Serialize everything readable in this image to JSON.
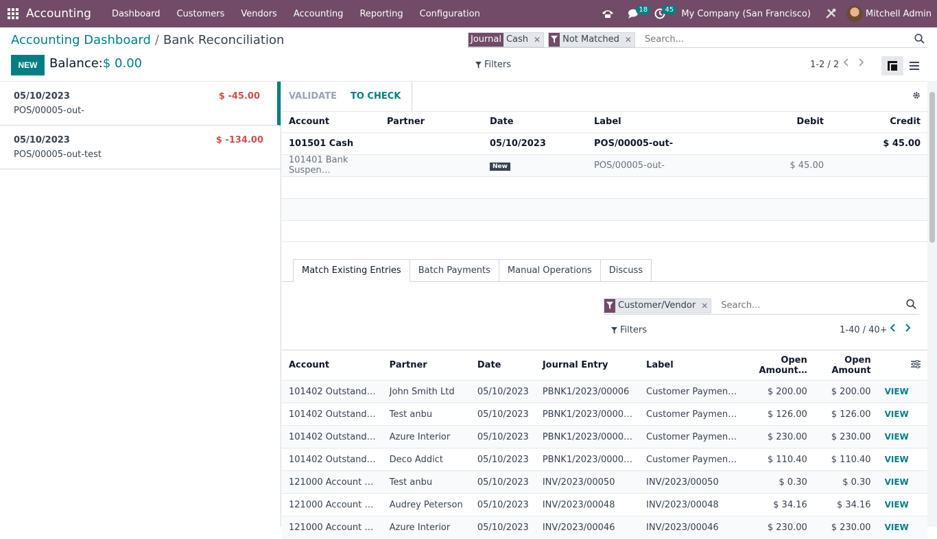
{
  "app": {
    "name": "Accounting"
  },
  "menu": [
    {
      "label": "Dashboard"
    },
    {
      "label": "Customers"
    },
    {
      "label": "Vendors"
    },
    {
      "label": "Accounting"
    },
    {
      "label": "Reporting"
    },
    {
      "label": "Configuration"
    }
  ],
  "topbar": {
    "messages_count": "18",
    "activities_count": "45",
    "company": "My Company (San Francisco)",
    "user": "Mitchell Admin"
  },
  "breadcrumb": {
    "parent": "Accounting Dashboard",
    "current": "Bank Reconciliation"
  },
  "controls": {
    "new_label": "NEW",
    "balance_label": "Balance:",
    "balance_value": "$ 0.00",
    "filters_label": "Filters",
    "pager": "1-2 / 2",
    "search_placeholder": "Search..."
  },
  "facets": [
    {
      "label": "Journal",
      "value": "Cash"
    },
    {
      "label": "",
      "value": "Not Matched"
    }
  ],
  "statement_lines": [
    {
      "date": "05/10/2023",
      "label": "POS/00005-out-",
      "amount": "$ -45.00"
    },
    {
      "date": "05/10/2023",
      "label": "POS/00005-out-test",
      "amount": "$ -134.00"
    }
  ],
  "actions": {
    "validate": "VALIDATE",
    "to_check": "TO CHECK"
  },
  "reco_table": {
    "headers": [
      "Account",
      "Partner",
      "Date",
      "Label",
      "Debit",
      "Credit"
    ],
    "rows": [
      {
        "account": "101501 Cash",
        "partner": "",
        "date": "05/10/2023",
        "label": "POS/00005-out-",
        "debit": "",
        "credit": "$ 45.00"
      },
      {
        "account": "101401 Bank Suspen…",
        "partner": "",
        "date": "New",
        "label": "POS/00005-out-",
        "debit": "$ 45.00",
        "credit": ""
      }
    ]
  },
  "tabs": [
    {
      "label": "Match Existing Entries"
    },
    {
      "label": "Batch Payments"
    },
    {
      "label": "Manual Operations"
    },
    {
      "label": "Discuss"
    }
  ],
  "match_search": {
    "facet": "Customer/Vendor",
    "placeholder": "Search...",
    "filters_label": "Filters",
    "pager": "1-40 / 40+"
  },
  "match_table": {
    "headers": [
      "Account",
      "Partner",
      "Date",
      "Journal Entry",
      "Label",
      "Open Amount…",
      "Open Amount"
    ],
    "view_label": "VIEW",
    "rows": [
      {
        "account": "101402 Outstand…",
        "partner": "John Smith Ltd",
        "date": "05/10/2023",
        "entry": "PBNK1/2023/00006",
        "label": "Customer Paymen…",
        "amount_cur": "$ 200.00",
        "amount": "$ 200.00"
      },
      {
        "account": "101402 Outstand…",
        "partner": "Test anbu",
        "date": "05/10/2023",
        "entry": "PBNK1/2023/0000…",
        "label": "Customer Paymen…",
        "amount_cur": "$ 126.00",
        "amount": "$ 126.00"
      },
      {
        "account": "101402 Outstand…",
        "partner": "Azure Interior",
        "date": "05/10/2023",
        "entry": "PBNK1/2023/0000…",
        "label": "Customer Paymen…",
        "amount_cur": "$ 230.00",
        "amount": "$ 230.00"
      },
      {
        "account": "101402 Outstand…",
        "partner": "Deco Addict",
        "date": "05/10/2023",
        "entry": "PBNK1/2023/0000…",
        "label": "Customer Paymen…",
        "amount_cur": "$ 110.40",
        "amount": "$ 110.40"
      },
      {
        "account": "121000 Account …",
        "partner": "Test anbu",
        "date": "05/10/2023",
        "entry": "INV/2023/00050",
        "label": "INV/2023/00050",
        "amount_cur": "$ 0.30",
        "amount": "$ 0.30"
      },
      {
        "account": "121000 Account …",
        "partner": "Audrey Peterson",
        "date": "05/10/2023",
        "entry": "INV/2023/00048",
        "label": "INV/2023/00048",
        "amount_cur": "$ 34.16",
        "amount": "$ 34.16"
      },
      {
        "account": "121000 Account …",
        "partner": "Azure Interior",
        "date": "05/10/2023",
        "entry": "INV/2023/00046",
        "label": "INV/2023/00046",
        "amount_cur": "$ 230.00",
        "amount": "$ 230.00"
      }
    ]
  },
  "colors": {
    "brand": "#714B67",
    "accent": "#017E84",
    "negative": "#d44c4c"
  }
}
